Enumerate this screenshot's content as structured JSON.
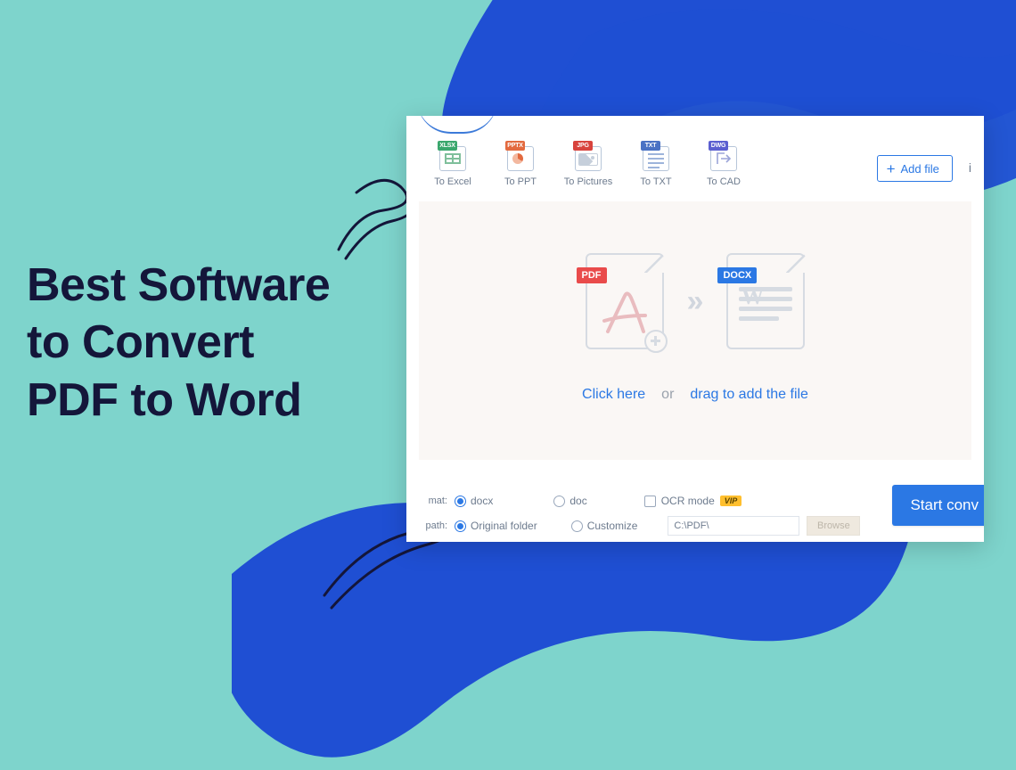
{
  "headline": {
    "line1": "Best Software",
    "line2": "to Convert",
    "line3": "PDF to Word"
  },
  "toolbar": {
    "items": [
      {
        "label": "To Excel",
        "badge": "XLSX",
        "name": "to-excel"
      },
      {
        "label": "To PPT",
        "badge": "PPTX",
        "name": "to-ppt"
      },
      {
        "label": "To Pictures",
        "badge": "JPG",
        "name": "to-pictures"
      },
      {
        "label": "To TXT",
        "badge": "TXT",
        "name": "to-txt"
      },
      {
        "label": "To CAD",
        "badge": "DWG",
        "name": "to-cad"
      }
    ],
    "add_file_label": "Add file"
  },
  "drop": {
    "pdf_badge": "PDF",
    "docx_badge": "DOCX",
    "click_here": "Click here",
    "or": "or",
    "drag_hint": "drag to add the file"
  },
  "settings": {
    "format_label": "mat:",
    "docx_opt": "docx",
    "doc_opt": "doc",
    "ocr_label": "OCR mode",
    "vip": "VIP",
    "path_label": "path:",
    "original_folder": "Original folder",
    "customize": "Customize",
    "path_value": "C:\\PDF\\",
    "browse_label": "Browse",
    "start_label": "Start conv"
  },
  "colors": {
    "accent_blue": "#2b78e4",
    "bg_teal": "#7ed4cc",
    "brush_blue": "#1f4fd3",
    "pdf_red": "#e94b4b",
    "docx_blue": "#2b78e4"
  }
}
